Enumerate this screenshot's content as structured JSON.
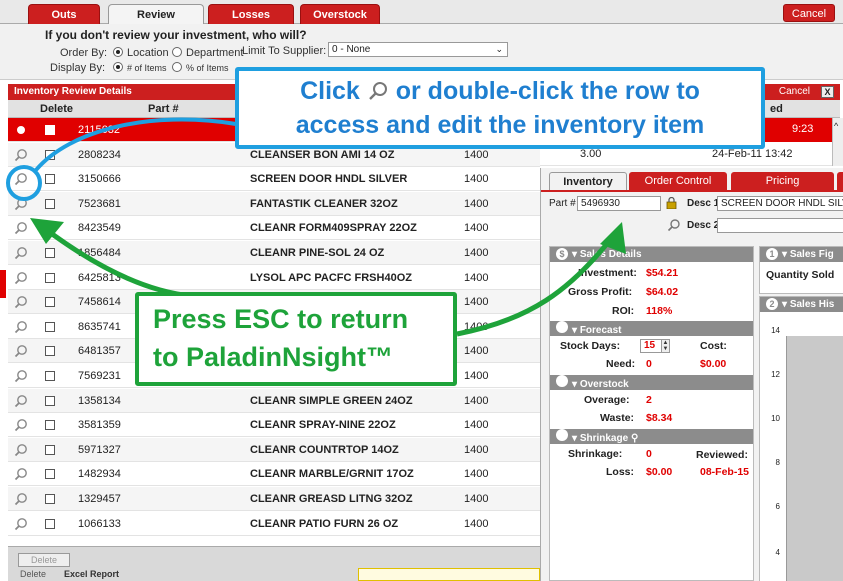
{
  "top_tabs": [
    "Outs",
    "Review",
    "Losses",
    "Overstock"
  ],
  "top_cancel": "Cancel",
  "review_options": {
    "question": "If you don't review your investment, who will?",
    "order_by_label": "Order By:",
    "order_by_options": [
      "Location",
      "Department"
    ],
    "display_by_label": "Display By:",
    "display_by_options": [
      "# of Items",
      "% of Items"
    ],
    "limit_label": "Limit To Supplier:",
    "supplier_value": "0 - None"
  },
  "panel": {
    "title": "Inventory Review Details",
    "cancel": "Cancel",
    "close": "X",
    "columns": {
      "delete": "Delete",
      "part": "Part #",
      "reviewed_fragment": "ed"
    }
  },
  "rows": [
    {
      "part": "2115632",
      "desc": "",
      "store": "",
      "extra": "9:23",
      "selected": true
    },
    {
      "part": "2808234",
      "desc": "CLEANSER BON AMI 14 OZ",
      "store": "1400",
      "extra": ""
    },
    {
      "part": "3150666",
      "desc": "SCREEN DOOR HNDL SILVER",
      "store": "1400",
      "extra": ""
    },
    {
      "part": "7523681",
      "desc": "FANTASTIK CLEANER 32OZ",
      "store": "1400",
      "extra": ""
    },
    {
      "part": "8423549",
      "desc": "CLEANR FORM409SPRAY 22OZ",
      "store": "1400",
      "extra": ""
    },
    {
      "part": "1856484",
      "desc": "CLEANR PINE-SOL 24 OZ",
      "store": "1400",
      "extra": ""
    },
    {
      "part": "6425813",
      "desc": "LYSOL APC PACFC FRSH40OZ",
      "store": "1400",
      "extra": ""
    },
    {
      "part": "7458614",
      "desc": "",
      "store": "1400",
      "extra": ""
    },
    {
      "part": "8635741",
      "desc": "",
      "store": "1400",
      "extra": ""
    },
    {
      "part": "6481357",
      "desc": "",
      "store": "1400",
      "extra": ""
    },
    {
      "part": "7569231",
      "desc": "CLEANR SIMPLE GREEN 32Z",
      "store": "1400",
      "extra": ""
    },
    {
      "part": "1358134",
      "desc": "CLEANR SIMPLE GREEN 24OZ",
      "store": "1400",
      "extra": ""
    },
    {
      "part": "3581359",
      "desc": "CLEANR SPRAY-NINE 22OZ",
      "store": "1400",
      "extra": ""
    },
    {
      "part": "5971327",
      "desc": "CLEANR COUNTRTOP 14OZ",
      "store": "1400",
      "extra": ""
    },
    {
      "part": "1482934",
      "desc": "CLEANR MARBLE/GRNIT 17OZ",
      "store": "1400",
      "extra": ""
    },
    {
      "part": "1329457",
      "desc": "CLEANR GREASD LITNG 32OZ",
      "store": "1400",
      "extra": ""
    },
    {
      "part": "1066133",
      "desc": "CLEANR PATIO FURN 26 OZ",
      "store": "1400",
      "extra": ""
    }
  ],
  "row2_extra": {
    "qty": "3.00",
    "reviewed": "24-Feb-11 13:42"
  },
  "footer": {
    "delete_button": "Delete",
    "delete_label": "Delete",
    "excel_label": "Excel Report"
  },
  "detail": {
    "tabs": [
      "Inventory",
      "Order Control",
      "Pricing"
    ],
    "part_label": "Part #",
    "part_value": "5496930",
    "desc1_label": "Desc 1",
    "desc1_value": "SCREEN DOOR HNDL SILVER",
    "desc2_label": "Desc 2",
    "desc2_value": "",
    "sales_details": {
      "title": "Sales Details",
      "investment_label": "Investment:",
      "investment": "$54.21",
      "gross_profit_label": "Gross Profit:",
      "gross_profit": "$64.02",
      "roi_label": "ROI:",
      "roi": "118%"
    },
    "forecast": {
      "title": "Forecast",
      "stock_days_label": "Stock Days:",
      "stock_days": "15",
      "cost_label": "Cost:",
      "cost": "$0.00",
      "need_label": "Need:",
      "need": "0"
    },
    "overstock": {
      "title": "Overstock",
      "overage_label": "Overage:",
      "overage": "2",
      "waste_label": "Waste:",
      "waste": "$8.34"
    },
    "shrinkage": {
      "title": "Shrinkage",
      "shrinkage_label": "Shrinkage:",
      "shrinkage": "0",
      "reviewed_label": "Reviewed:",
      "reviewed": "08-Feb-15",
      "loss_label": "Loss:",
      "loss": "$0.00"
    },
    "sales_figures": {
      "num": "1",
      "title": "Sales Fig",
      "quantity_label": "Quantity Sold"
    },
    "sales_history": {
      "num": "2",
      "title": "Sales His",
      "ticks": [
        "14",
        "12",
        "10",
        "8",
        "6",
        "4"
      ]
    },
    "sales_details_num": "$"
  },
  "callouts": {
    "blue_line1": "Click  or double-click the row to",
    "blue_line2": "access and edit the inventory item",
    "green_line1": "Press ESC to return",
    "green_line2": "to PaladinNsight™"
  },
  "colors": {
    "brand_red": "#cc1f1f",
    "callout_blue": "#1f9fe0",
    "callout_green": "#1ea33a"
  }
}
